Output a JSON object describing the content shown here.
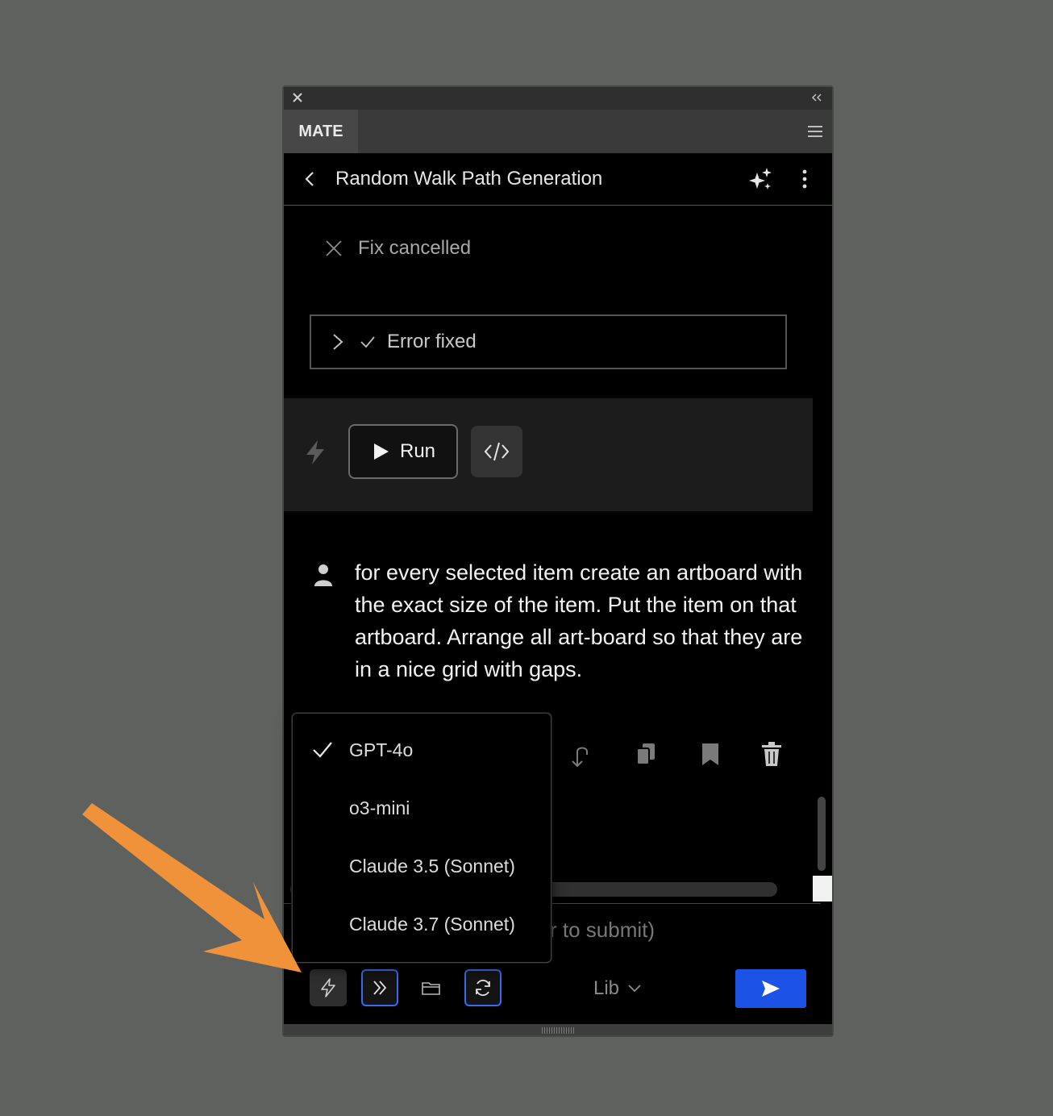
{
  "panel": {
    "tab_label": "MATE",
    "header_title": "Random Walk Path Generation"
  },
  "conversation": {
    "fix_status": "Fix cancelled",
    "error_status": "Error fixed",
    "run_label": "Run",
    "user_message": "for every selected item create an artboard with the exact size of the item. Put the item on that artboard. Arrange all art-board so that they are in a nice grid with gaps."
  },
  "input": {
    "hint_fragment": "r to submit)"
  },
  "bottom_bar": {
    "library_label": "Lib"
  },
  "model_menu": {
    "selected": "GPT-4o",
    "items": [
      {
        "label": "GPT-4o"
      },
      {
        "label": "o3-mini"
      },
      {
        "label": "Claude 3.5 (Sonnet)"
      },
      {
        "label": "Claude 3.7 (Sonnet)"
      }
    ]
  },
  "colors": {
    "background": "#5f615f",
    "panel": "#000000",
    "accent_blue": "#1c52e6",
    "focus_border": "#3b6af0",
    "annotation_arrow": "#f0923a"
  },
  "icons": [
    "close-icon",
    "collapse-icon",
    "menu-icon",
    "back-icon",
    "sparkle-icon",
    "more-icon",
    "x-icon",
    "chevron-right-icon",
    "check-icon",
    "bolt-icon",
    "play-icon",
    "code-icon",
    "user-icon",
    "undo-icon",
    "copy-icon",
    "bookmark-icon",
    "trash-icon",
    "forward-icon",
    "folder-icon",
    "sync-icon",
    "chevron-down-icon",
    "send-icon"
  ]
}
